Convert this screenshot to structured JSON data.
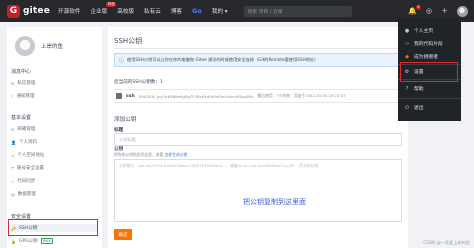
{
  "nav": {
    "logo": "gitee",
    "logo_mark": "G",
    "links": [
      "开源软件",
      "企业版",
      "高校版",
      "私有云",
      "博客",
      "Go",
      "我的 ▾"
    ],
    "enterprise_badge": "特惠",
    "search_placeholder": "搜索 项目 / 仓库",
    "notif_count": "6",
    "icons": [
      "bell-icon",
      "map-pin-icon",
      "plus-icon",
      "avatar"
    ]
  },
  "sidebar": {
    "username": "上岸的鱼",
    "sections": [
      {
        "title": "消息中心",
        "items": [
          "私信管理",
          "通知管理"
        ]
      },
      {
        "title": "基本设置",
        "items": [
          "邮箱管理",
          "个人资料",
          "个人空间地址",
          "账号安全设置",
          "代码同步",
          "数据管理"
        ]
      },
      {
        "title": "安全设置",
        "items": [
          "SSH公钥",
          "GPG公钥"
        ]
      }
    ],
    "gpg_tag": "Beta"
  },
  "main": {
    "title": "SSH公钥",
    "info_text": "使用SSH公钥可以让你在你的电脑和 Gitee 通讯的时候使用安全连接（Git的Remote要使用SSH地址）",
    "key_count": "您当前的SSH公钥数：1",
    "key_name": "ssh",
    "key_fingerprint": "SHA256:-Jy/y3rKKBdeKgRg7F/SIaHYdFe0dEm4rAnyNSbg5Ms",
    "key_meta": "最后使用：7小时前 · 添加于2022-10-04 19:22:07",
    "add_title": "添加公钥",
    "label_title": "标题",
    "title_placeholder": "公钥标题",
    "label_key": "公钥",
    "hint": "把你的公钥粘贴到这里，查看",
    "hint_link": "怎样生成公钥",
    "key_placeholder": "公钥格式：ssh-ed25519 AAAAC3NzaC1lZDI1NTE5AAAA...，或者以 ssh-rsa AAAAB3NzaC1yc2E... 开头的公钥",
    "overlay": "把公钥复制到这里面",
    "submit": "确定"
  },
  "dropdown": {
    "items": [
      "个人主页",
      "我的代码片段",
      "成为捐赠者",
      "设置",
      "帮助",
      "退出"
    ],
    "icons": [
      "user-icon",
      "code-icon",
      "gift-icon",
      "settings-icon",
      "help-icon",
      "logout-icon"
    ]
  },
  "watermark": "CSDN @一条爱上岸的鱼",
  "colors": {
    "brand": "#c71d23",
    "nav_bg": "#26282c",
    "accent_orange": "#fe7300",
    "highlight": "#e2282c",
    "link": "#2c7ad6"
  }
}
